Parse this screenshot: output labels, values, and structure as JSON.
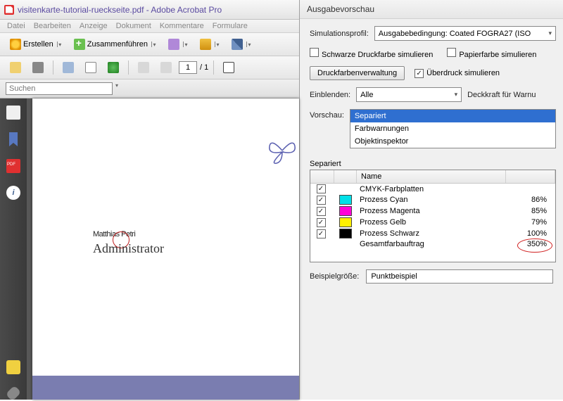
{
  "window": {
    "title": "visitenkarte-tutorial-rueckseite.pdf - Adobe Acrobat Pro"
  },
  "menu": {
    "file": "Datei",
    "edit": "Bearbeiten",
    "view": "Anzeige",
    "doc": "Dokument",
    "comments": "Kommentare",
    "forms": "Formulare"
  },
  "toolbar": {
    "create": "Erstellen",
    "combine": "Zusammenführen",
    "page": "1",
    "pages": "/ 1"
  },
  "search": {
    "placeholder": "Suchen"
  },
  "card": {
    "name_first": "Matthias",
    "name_last": "Petri",
    "role": "Administrator"
  },
  "panel": {
    "title": "Ausgabevorschau",
    "simprofile_lbl": "Simulationsprofil:",
    "simprofile_val": "Ausgabebedingung: Coated FOGRA27 (ISO",
    "cb_black": "Schwarze Druckfarbe simulieren",
    "cb_paper": "Papierfarbe simulieren",
    "btn_ink": "Druckfarbenverwaltung",
    "cb_overprint": "Überdruck simulieren",
    "show_lbl": "Einblenden:",
    "show_val": "Alle",
    "opacity_lbl": "Deckkraft für Warnu",
    "preview_lbl": "Vorschau:",
    "preview_opts": {
      "sep": "Separiert",
      "warn": "Farbwarnungen",
      "obj": "Objektinspektor"
    },
    "sep_group": "Separiert",
    "th_name": "Name",
    "rows": [
      {
        "color": "",
        "name": "CMYK-Farbplatten",
        "pct": ""
      },
      {
        "color": "#00e0e8",
        "name": "Prozess Cyan",
        "pct": "86%"
      },
      {
        "color": "#ff00d8",
        "name": "Prozess Magenta",
        "pct": "85%"
      },
      {
        "color": "#fff000",
        "name": "Prozess Gelb",
        "pct": "79%"
      },
      {
        "color": "#000000",
        "name": "Prozess Schwarz",
        "pct": "100%"
      }
    ],
    "total_name": "Gesamtfarbauftrag",
    "total_pct": "350%",
    "sample_lbl": "Beispielgröße:",
    "sample_val": "Punktbeispiel"
  }
}
